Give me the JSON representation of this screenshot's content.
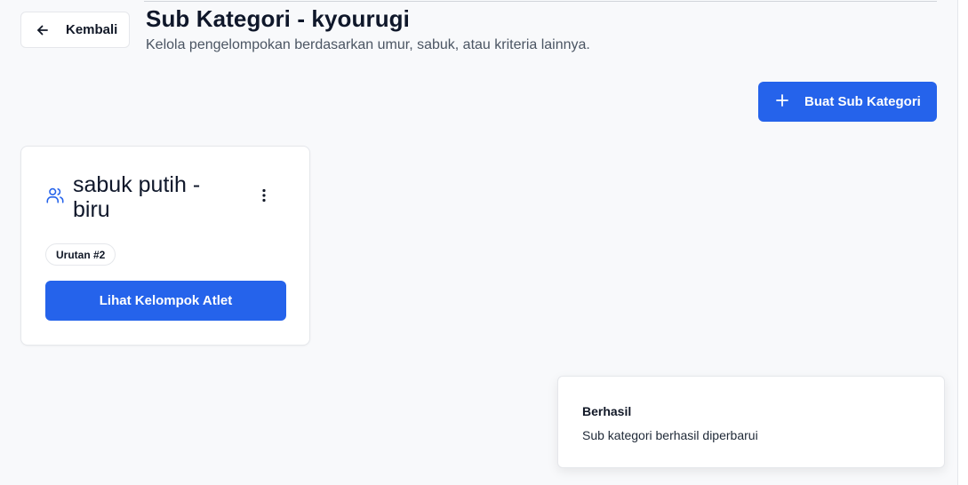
{
  "header": {
    "back_label": "Kembali",
    "title": "Sub Kategori - kyourugi",
    "subtitle": "Kelola pengelompokan berdasarkan umur, sabuk, atau kriteria lainnya."
  },
  "toolbar": {
    "create_label": "Buat Sub Kategori"
  },
  "cards": [
    {
      "icon": "users-icon",
      "title": "sabuk putih - biru",
      "order_badge": "Urutan #2",
      "action_label": "Lihat Kelompok Atlet"
    }
  ],
  "toast": {
    "title": "Berhasil",
    "message": "Sub kategori berhasil diperbarui"
  },
  "colors": {
    "primary": "#2563eb",
    "background": "#f8f9fb",
    "card": "#ffffff",
    "icon_accent": "#2563eb"
  }
}
